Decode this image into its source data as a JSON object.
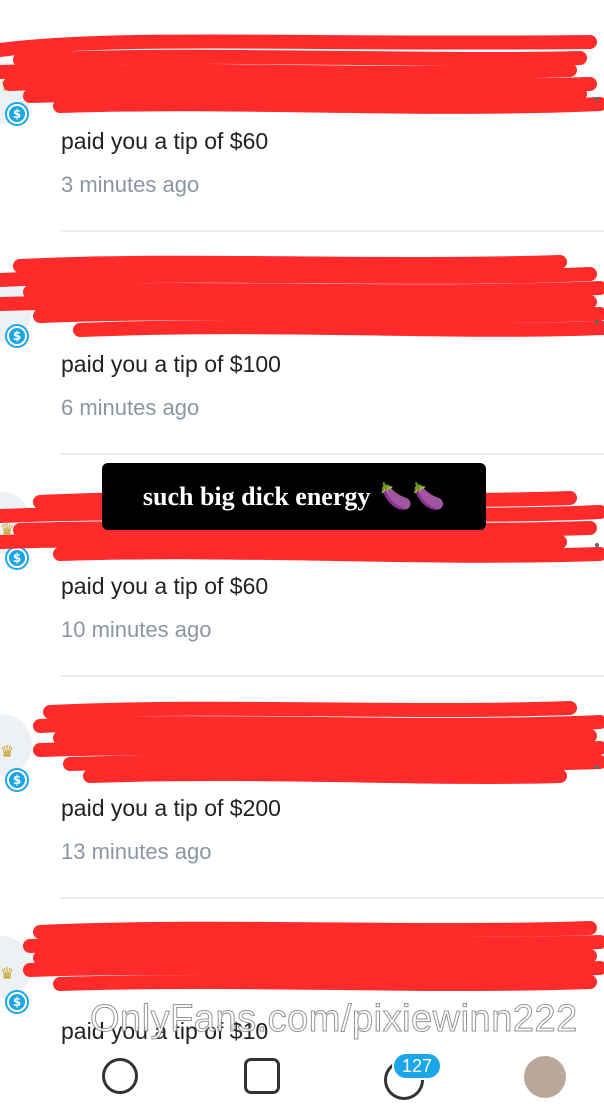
{
  "notifications": [
    {
      "tip": "paid you a tip of $60",
      "time": "3 minutes ago"
    },
    {
      "tip": "paid you a tip of $100",
      "time": "6 minutes ago"
    },
    {
      "tip": "paid you a tip of $60",
      "time": "10 minutes ago"
    },
    {
      "tip": "paid you a tip of $200",
      "time": "13 minutes ago"
    },
    {
      "tip": "paid you a tip of $10",
      "time": ""
    }
  ],
  "overlay": {
    "caption": "such big dick energy",
    "emoji": "🍆🍆"
  },
  "watermark": "OnlyFans.com/pixiewinn222",
  "tabbar": {
    "messages_count": "127"
  },
  "colors": {
    "accent": "#1aa6e8",
    "redaction": "#ff2a2a"
  },
  "icons": {
    "badge": "dollar-icon",
    "crown": "crown-icon"
  }
}
